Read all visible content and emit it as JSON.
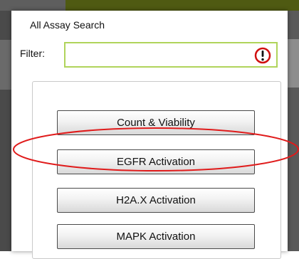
{
  "dialog": {
    "title": "All Assay Search",
    "filter": {
      "label": "Filter:",
      "value": "",
      "placeholder": ""
    }
  },
  "assays": [
    {
      "label": "Count & Viability"
    },
    {
      "label": "EGFR Activation"
    },
    {
      "label": "H2A.X Activation"
    },
    {
      "label": "MAPK Activation"
    }
  ],
  "colors": {
    "filter_border": "#b0d45b",
    "warning_red": "#d01010",
    "highlight_red": "#e01b1b",
    "header_green": "#4f5a12"
  },
  "icons": {
    "filter_status": "warning-icon"
  }
}
